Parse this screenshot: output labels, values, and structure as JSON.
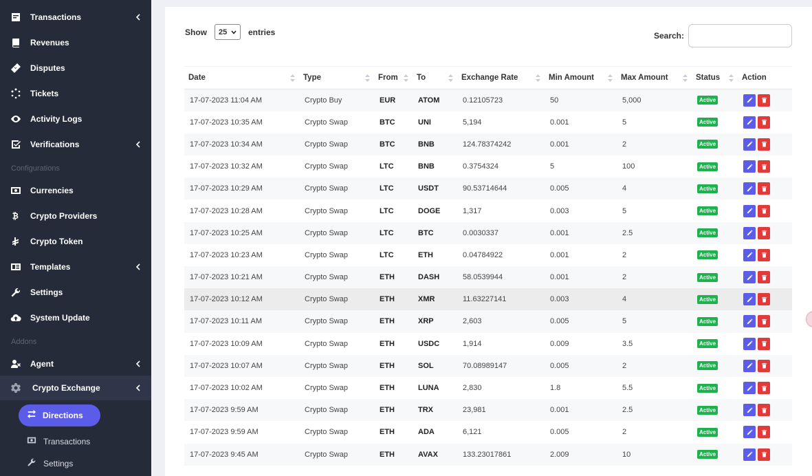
{
  "sidebar": {
    "items": [
      {
        "label": "Transactions",
        "icon": "receipt-icon",
        "chevron": true
      },
      {
        "label": "Revenues",
        "icon": "book-icon",
        "chevron": false
      },
      {
        "label": "Disputes",
        "icon": "bandage-icon",
        "chevron": false
      },
      {
        "label": "Tickets",
        "icon": "spinner-icon",
        "chevron": false
      },
      {
        "label": "Activity Logs",
        "icon": "eye-icon",
        "chevron": false
      },
      {
        "label": "Verifications",
        "icon": "check-square-icon",
        "chevron": true
      }
    ],
    "section_configurations": "Configurations",
    "config_items": [
      {
        "label": "Currencies",
        "icon": "money-bill-icon",
        "chevron": false
      },
      {
        "label": "Crypto Providers",
        "icon": "bitcoin-icon",
        "chevron": false
      },
      {
        "label": "Crypto Token",
        "icon": "tenge-icon",
        "chevron": false
      },
      {
        "label": "Templates",
        "icon": "newspaper-icon",
        "chevron": true
      },
      {
        "label": "Settings",
        "icon": "wrench-icon",
        "chevron": false
      },
      {
        "label": "System Update",
        "icon": "cloud-upload-icon",
        "chevron": false
      }
    ],
    "section_addons": "Addons",
    "addon_items": [
      {
        "label": "Agent",
        "icon": "user-x-icon",
        "chevron": true
      },
      {
        "label": "Crypto Exchange",
        "icon": "cogs-icon",
        "chevron": true
      }
    ],
    "sub_items": [
      {
        "label": "Directions",
        "icon": "exchange-icon"
      },
      {
        "label": "Transactions",
        "icon": "money-bill-icon"
      },
      {
        "label": "Settings",
        "icon": "wrench-icon"
      }
    ]
  },
  "table_controls": {
    "show_label": "Show",
    "entries_value": "25",
    "entries_label": "entries",
    "search_label": "Search:",
    "search_value": ""
  },
  "columns": [
    "Date",
    "Type",
    "From",
    "To",
    "Exchange Rate",
    "Min Amount",
    "Max Amount",
    "Status",
    "Action"
  ],
  "rows": [
    {
      "date": "17-07-2023 11:04 AM",
      "type": "Crypto Buy",
      "from": "EUR",
      "to": "ATOM",
      "rate": "0.12105723",
      "min": "50",
      "max": "5,000",
      "status": "Active"
    },
    {
      "date": "17-07-2023 10:35 AM",
      "type": "Crypto Swap",
      "from": "BTC",
      "to": "UNI",
      "rate": "5,194",
      "min": "0.001",
      "max": "5",
      "status": "Active"
    },
    {
      "date": "17-07-2023 10:34 AM",
      "type": "Crypto Swap",
      "from": "BTC",
      "to": "BNB",
      "rate": "124.78374242",
      "min": "0.001",
      "max": "2",
      "status": "Active"
    },
    {
      "date": "17-07-2023 10:32 AM",
      "type": "Crypto Swap",
      "from": "LTC",
      "to": "BNB",
      "rate": "0.3754324",
      "min": "5",
      "max": "100",
      "status": "Active"
    },
    {
      "date": "17-07-2023 10:29 AM",
      "type": "Crypto Swap",
      "from": "LTC",
      "to": "USDT",
      "rate": "90.53714644",
      "min": "0.005",
      "max": "4",
      "status": "Active"
    },
    {
      "date": "17-07-2023 10:28 AM",
      "type": "Crypto Swap",
      "from": "LTC",
      "to": "DOGE",
      "rate": "1,317",
      "min": "0.003",
      "max": "5",
      "status": "Active"
    },
    {
      "date": "17-07-2023 10:25 AM",
      "type": "Crypto Swap",
      "from": "LTC",
      "to": "BTC",
      "rate": "0.0030337",
      "min": "0.001",
      "max": "2.5",
      "status": "Active"
    },
    {
      "date": "17-07-2023 10:23 AM",
      "type": "Crypto Swap",
      "from": "LTC",
      "to": "ETH",
      "rate": "0.04784922",
      "min": "0.001",
      "max": "2",
      "status": "Active"
    },
    {
      "date": "17-07-2023 10:21 AM",
      "type": "Crypto Swap",
      "from": "ETH",
      "to": "DASH",
      "rate": "58.0539944",
      "min": "0.001",
      "max": "2",
      "status": "Active"
    },
    {
      "date": "17-07-2023 10:12 AM",
      "type": "Crypto Swap",
      "from": "ETH",
      "to": "XMR",
      "rate": "11.63227141",
      "min": "0.003",
      "max": "4",
      "status": "Active"
    },
    {
      "date": "17-07-2023 10:11 AM",
      "type": "Crypto Swap",
      "from": "ETH",
      "to": "XRP",
      "rate": "2,603",
      "min": "0.005",
      "max": "5",
      "status": "Active"
    },
    {
      "date": "17-07-2023 10:09 AM",
      "type": "Crypto Swap",
      "from": "ETH",
      "to": "USDC",
      "rate": "1,914",
      "min": "0.009",
      "max": "3.5",
      "status": "Active"
    },
    {
      "date": "17-07-2023 10:07 AM",
      "type": "Crypto Swap",
      "from": "ETH",
      "to": "SOL",
      "rate": "70.08989147",
      "min": "0.005",
      "max": "2",
      "status": "Active"
    },
    {
      "date": "17-07-2023 10:02 AM",
      "type": "Crypto Swap",
      "from": "ETH",
      "to": "LUNA",
      "rate": "2,830",
      "min": "1.8",
      "max": "5.5",
      "status": "Active"
    },
    {
      "date": "17-07-2023 9:59 AM",
      "type": "Crypto Swap",
      "from": "ETH",
      "to": "TRX",
      "rate": "23,981",
      "min": "0.001",
      "max": "2.5",
      "status": "Active"
    },
    {
      "date": "17-07-2023 9:59 AM",
      "type": "Crypto Swap",
      "from": "ETH",
      "to": "ADA",
      "rate": "6,121",
      "min": "0.005",
      "max": "2",
      "status": "Active"
    },
    {
      "date": "17-07-2023 9:45 AM",
      "type": "Crypto Swap",
      "from": "ETH",
      "to": "AVAX",
      "rate": "133.23017861",
      "min": "2.009",
      "max": "10",
      "status": "Active"
    }
  ],
  "colors": {
    "sidebar_bg": "#262b39",
    "accent": "#5b5de8",
    "active_badge": "#1fb14e",
    "delete": "#e23a3a"
  }
}
